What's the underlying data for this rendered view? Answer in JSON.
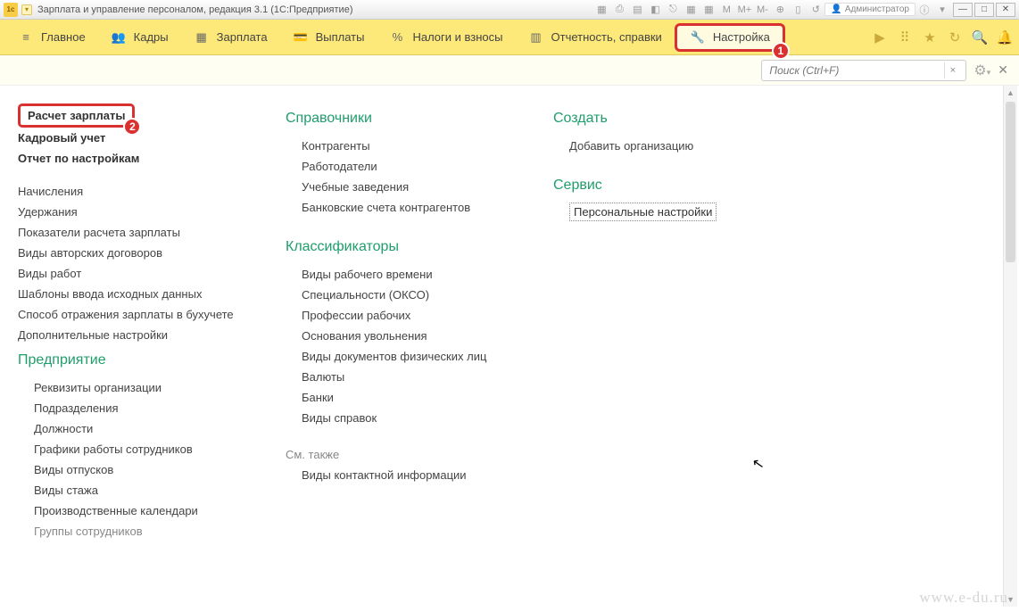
{
  "window": {
    "title": "Зарплата и управление персоналом, редакция 3.1  (1С:Предприятие)",
    "admin_label": "Администратор"
  },
  "toolbar_letters": {
    "m": "M",
    "mplus": "M+",
    "mminus": "M-"
  },
  "menu": {
    "main": "Главное",
    "kadry": "Кадры",
    "zarplata": "Зарплата",
    "vyplaty": "Выплаты",
    "nalogi": "Налоги и взносы",
    "otchet": "Отчетность, справки",
    "nastroika": "Настройка"
  },
  "badges": {
    "one": "1",
    "two": "2"
  },
  "search": {
    "placeholder": "Поиск (Ctrl+F)",
    "clear": "×"
  },
  "col1": {
    "top": [
      "Расчет зарплаты",
      "Кадровый учет",
      "Отчет по настройкам"
    ],
    "items": [
      "Начисления",
      "Удержания",
      "Показатели расчета зарплаты",
      "Виды авторских договоров",
      "Виды работ",
      "Шаблоны ввода исходных данных",
      "Способ отражения зарплаты в бухучете",
      "Дополнительные настройки"
    ],
    "head2": "Предприятие",
    "items2": [
      "Реквизиты организации",
      "Подразделения",
      "Должности",
      "Графики работы сотрудников",
      "Виды отпусков",
      "Виды стажа",
      "Производственные календари",
      "Группы сотрудников"
    ]
  },
  "col2": {
    "head1": "Справочники",
    "items1": [
      "Контрагенты",
      "Работодатели",
      "Учебные заведения",
      "Банковские счета контрагентов"
    ],
    "head2": "Классификаторы",
    "items2": [
      "Виды рабочего времени",
      "Специальности (ОКСО)",
      "Профессии рабочих",
      "Основания увольнения",
      "Виды документов физических лиц",
      "Валюты",
      "Банки",
      "Виды справок"
    ],
    "see_also": "См. также",
    "items3": [
      "Виды контактной информации"
    ]
  },
  "col3": {
    "head1": "Создать",
    "items1": [
      "Добавить организацию"
    ],
    "head2": "Сервис",
    "items2": [
      "Персональные настройки"
    ]
  },
  "watermark": "www.e-du.ru"
}
